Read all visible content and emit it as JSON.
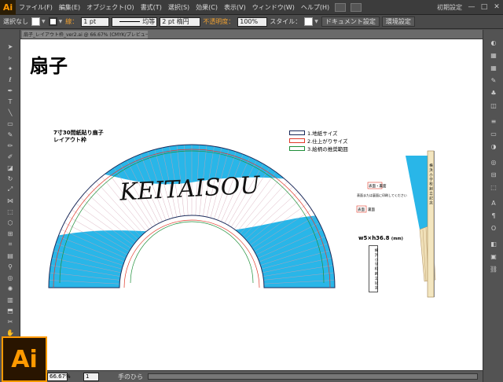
{
  "app": {
    "logo": "Ai"
  },
  "menu": {
    "items": [
      "ファイル(F)",
      "編集(E)",
      "オブジェクト(O)",
      "書式(T)",
      "選択(S)",
      "効果(C)",
      "表示(V)",
      "ウィンドウ(W)",
      "ヘルプ(H)"
    ],
    "workspace": "初期設定",
    "window_buttons": [
      "—",
      "□",
      "✕"
    ]
  },
  "controlbar": {
    "selection": "選択なし",
    "stroke_label": "線：",
    "stroke_value": "1 pt",
    "profile": "均等",
    "brush": "2 pt 楕円",
    "opacity_label": "不透明度：",
    "opacity_value": "100%",
    "style_label": "スタイル：",
    "doc_settings": "ドキュメント設定",
    "preferences": "環境設定"
  },
  "document": {
    "tab": "扇子_レイアウト枠_ver2.ai @ 66.67% (CMYK/プレビュー)",
    "title": "扇子",
    "caption_line1": "7寸30間紙貼り扇子",
    "caption_line2": "レイアウト枠",
    "legend": [
      {
        "label": "1.地紙サイズ",
        "color": "#1a2a5a"
      },
      {
        "label": "2.仕上がりサイズ",
        "color": "#e03a2a"
      },
      {
        "label": "3.絵柄の推奨範囲",
        "color": "#1f8f3a"
      }
    ],
    "fan_text": "KEITAISOU",
    "size_label": "w5×h36.8",
    "size_unit": "(mm)",
    "note_omote": "表面",
    "note_ura": "裏面",
    "note_desc": "表面または裏面に印刷してください",
    "card_text": "横 浜 小 学 校 創 立 記 念",
    "side_box_label": "表面・裏面",
    "fan_accent": "#29b6e8"
  },
  "status": {
    "zoom": "66.67%",
    "page": "1",
    "tool_name": "手のひら"
  }
}
